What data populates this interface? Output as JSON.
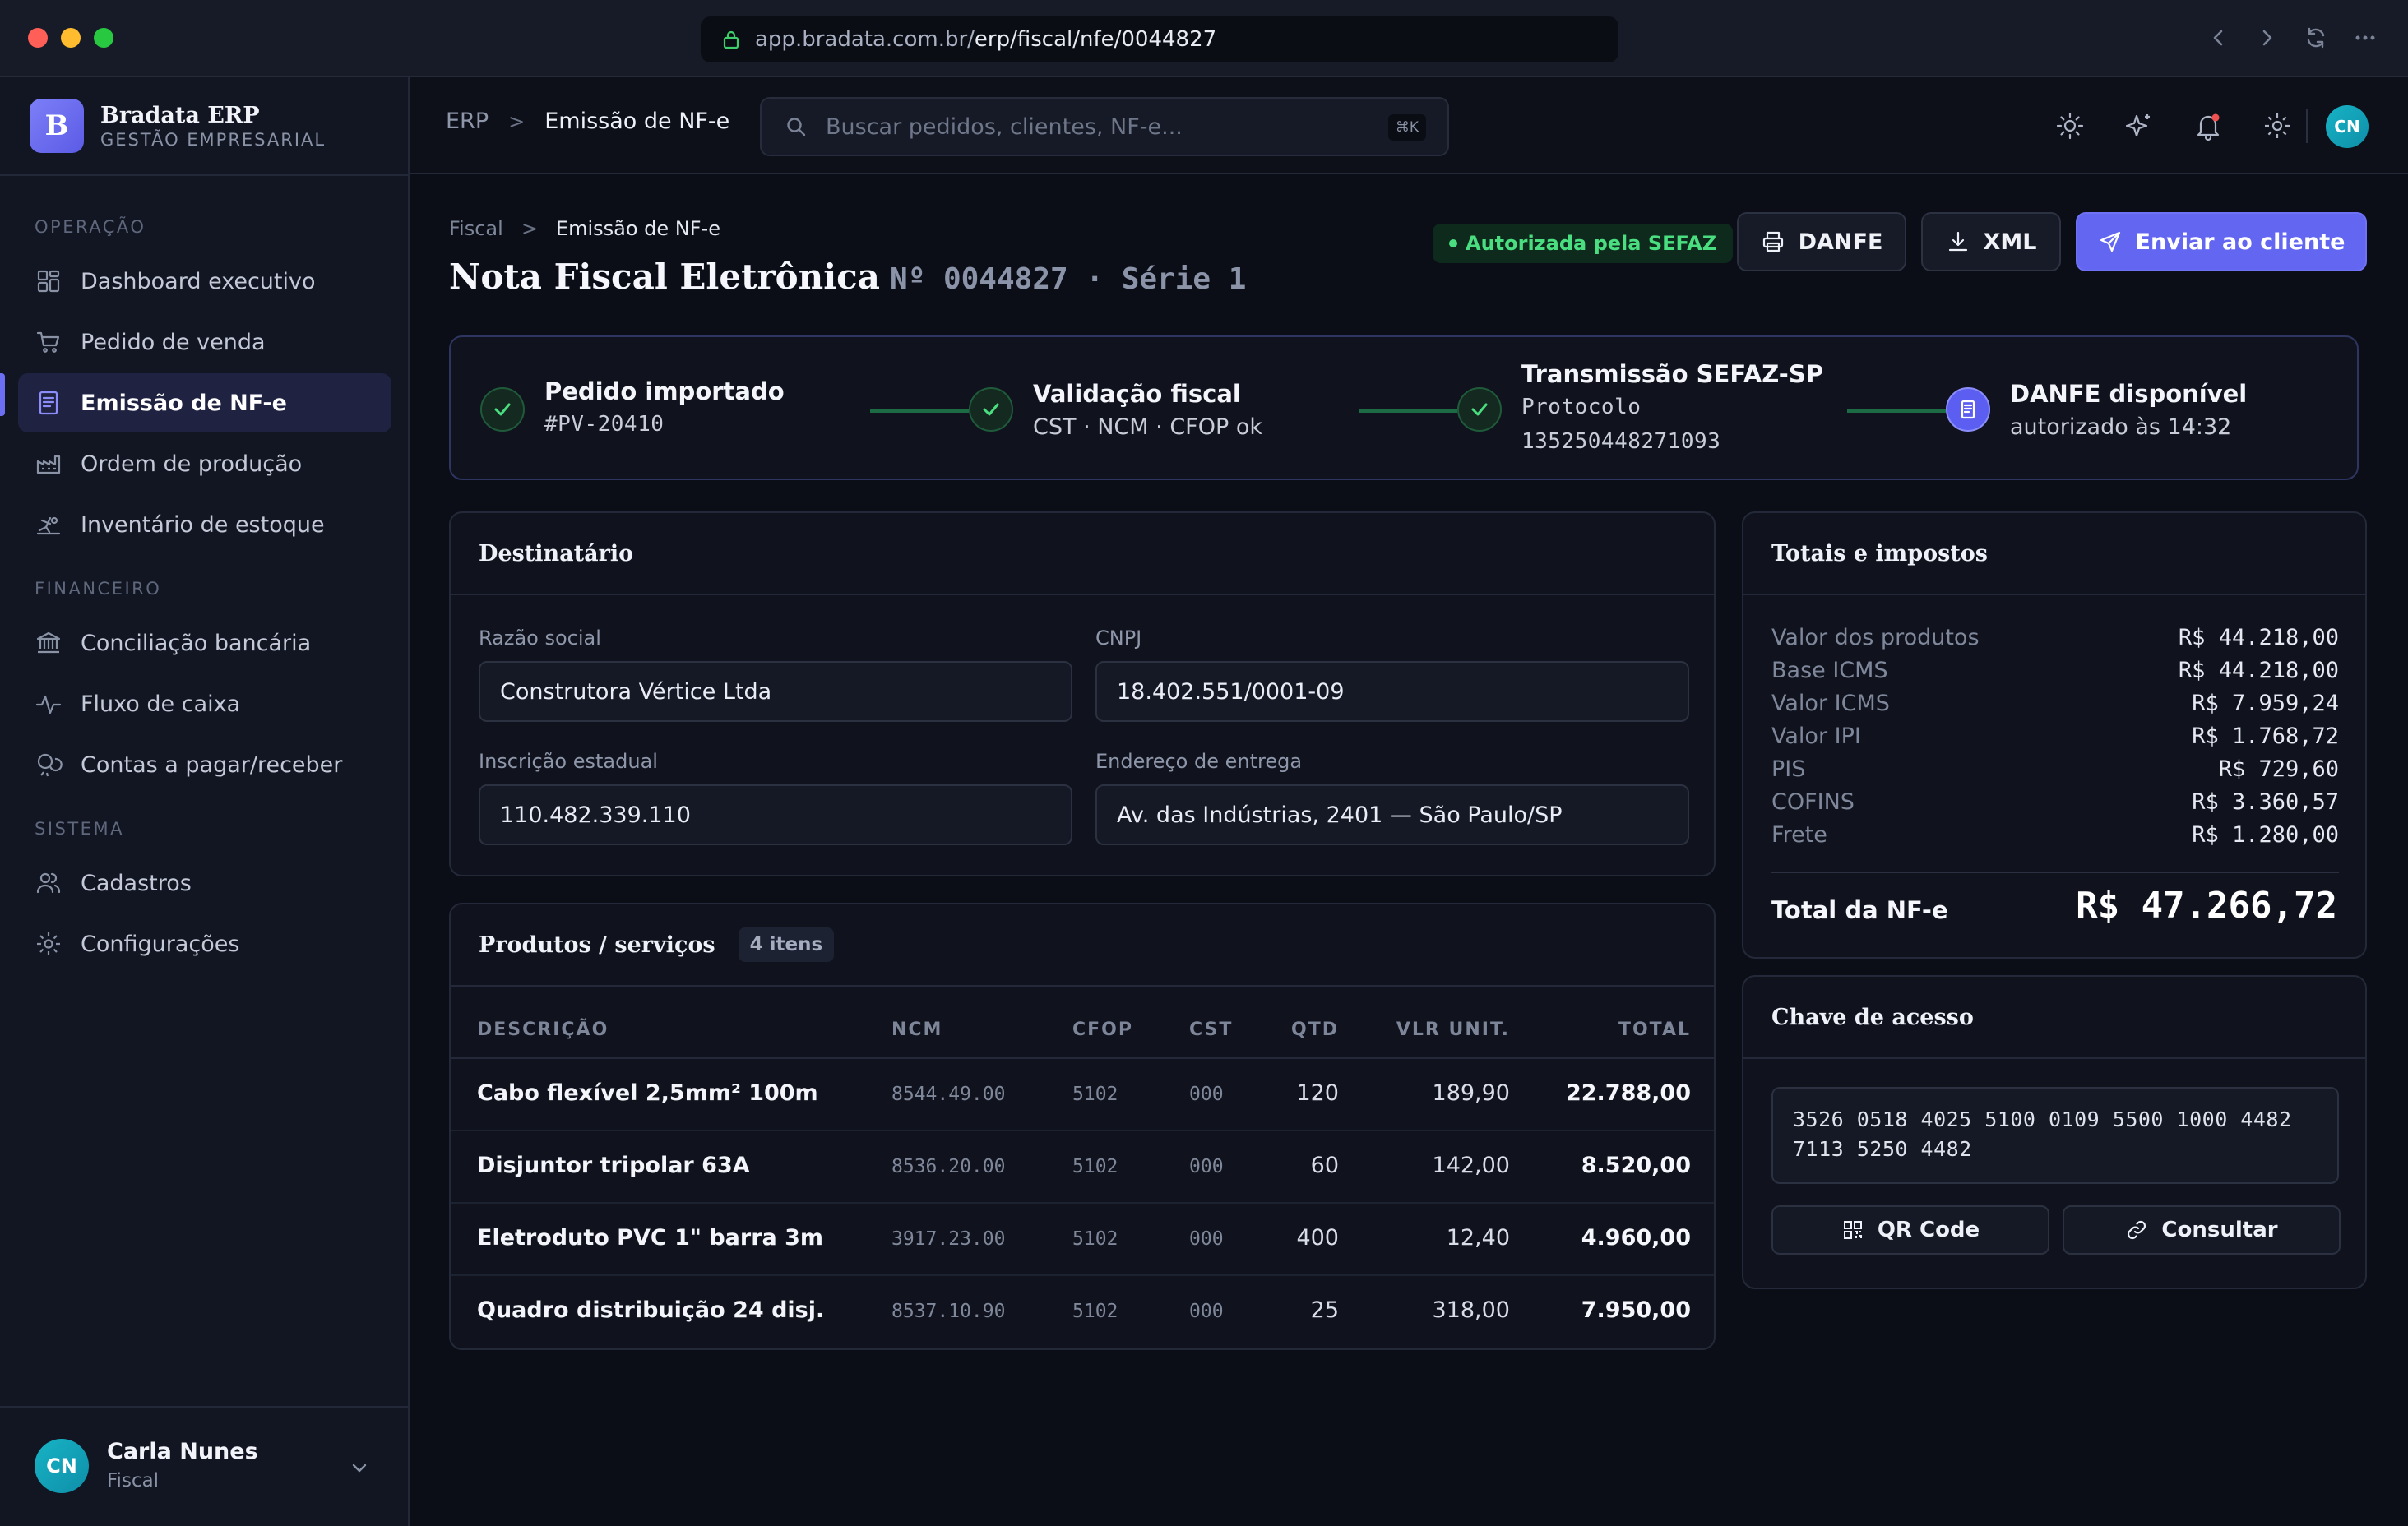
{
  "browser": {
    "url_domain": "app.bradata.com.br/",
    "url_path": "erp/fiscal/nfe/0044827"
  },
  "brand": {
    "logo_letter": "B",
    "name": "Bradata ERP",
    "subtitle": "GESTÃO EMPRESARIAL"
  },
  "sidebar": {
    "sections": [
      {
        "title": "OPERAÇÃO"
      },
      {
        "title": "FINANCEIRO"
      },
      {
        "title": "SISTEMA"
      }
    ],
    "items": [
      {
        "label": "Dashboard executivo",
        "icon": "dashboard-icon"
      },
      {
        "label": "Pedido de venda",
        "icon": "cart-icon"
      },
      {
        "label": "Emissão de NF-e",
        "icon": "invoice-icon",
        "active": true
      },
      {
        "label": "Ordem de produção",
        "icon": "factory-icon"
      },
      {
        "label": "Inventário de estoque",
        "icon": "forklift-icon"
      },
      {
        "label": "Conciliação bancária",
        "icon": "bank-icon"
      },
      {
        "label": "Fluxo de caixa",
        "icon": "activity-icon"
      },
      {
        "label": "Contas a pagar/receber",
        "icon": "coins-icon"
      },
      {
        "label": "Cadastros",
        "icon": "users-icon"
      },
      {
        "label": "Configurações",
        "icon": "gear-icon"
      }
    ],
    "user": {
      "initials": "CN",
      "name": "Carla Nunes",
      "role": "Fiscal"
    }
  },
  "topbar": {
    "breadcrumb": [
      "ERP",
      "Emissão de NF-e"
    ],
    "search_placeholder": "Buscar pedidos, clientes, NF-e...",
    "search_shortcut": "⌘K",
    "user_initials": "CN"
  },
  "page": {
    "breadcrumb": [
      "Fiscal",
      "Emissão de NF-e"
    ],
    "title": "Nota Fiscal Eletrônica",
    "number": "Nº 0044827 · Série 1",
    "status_badge": "Autorizada pela SEFAZ",
    "actions": {
      "danfe": "DANFE",
      "xml": "XML",
      "send": "Enviar ao cliente"
    }
  },
  "steps": [
    {
      "title": "Pedido importado",
      "sub": "#PV-20410",
      "state": "done"
    },
    {
      "title": "Validação fiscal",
      "sub": "CST · NCM · CFOP ok",
      "state": "done"
    },
    {
      "title": "Transmissão SEFAZ-SP",
      "sub": "Protocolo",
      "sub2": "135250448271093",
      "state": "done"
    },
    {
      "title": "DANFE disponível",
      "sub": "autorizado às 14:32",
      "state": "current"
    }
  ],
  "recipient": {
    "title": "Destinatário",
    "razao_label": "Razão social",
    "razao": "Construtora Vértice Ltda",
    "cnpj_label": "CNPJ",
    "cnpj": "18.402.551/0001-09",
    "ie_label": "Inscrição estadual",
    "ie": "110.482.339.110",
    "endereco_label": "Endereço de entrega",
    "endereco": "Av. das Indústrias, 2401 — São Paulo/SP"
  },
  "products": {
    "title": "Produtos / serviços",
    "count": "4 itens",
    "columns": [
      "DESCRIÇÃO",
      "NCM",
      "CFOP",
      "CST",
      "QTD",
      "VLR UNIT.",
      "TOTAL"
    ],
    "rows": [
      {
        "desc": "Cabo flexível 2,5mm² 100m",
        "ncm": "8544.49.00",
        "cfop": "5102",
        "cst": "000",
        "qtd": "120",
        "unit": "189,90",
        "total": "22.788,00"
      },
      {
        "desc": "Disjuntor tripolar 63A",
        "ncm": "8536.20.00",
        "cfop": "5102",
        "cst": "000",
        "qtd": "60",
        "unit": "142,00",
        "total": "8.520,00"
      },
      {
        "desc": "Eletroduto PVC 1\" barra 3m",
        "ncm": "3917.23.00",
        "cfop": "5102",
        "cst": "000",
        "qtd": "400",
        "unit": "12,40",
        "total": "4.960,00"
      },
      {
        "desc": "Quadro distribuição 24 disj.",
        "ncm": "8537.10.90",
        "cfop": "5102",
        "cst": "000",
        "qtd": "25",
        "unit": "318,00",
        "total": "7.950,00"
      }
    ]
  },
  "totals": {
    "title": "Totais e impostos",
    "rows": [
      {
        "k": "Valor dos produtos",
        "v": "R$ 44.218,00"
      },
      {
        "k": "Base ICMS",
        "v": "R$ 44.218,00"
      },
      {
        "k": "Valor ICMS",
        "v": "R$ 7.959,24"
      },
      {
        "k": "Valor IPI",
        "v": "R$ 1.768,72"
      },
      {
        "k": "PIS",
        "v": "R$ 729,60"
      },
      {
        "k": "COFINS",
        "v": "R$ 3.360,57"
      },
      {
        "k": "Frete",
        "v": "R$ 1.280,00"
      }
    ],
    "total_label": "Total da NF-e",
    "total_value": "R$ 47.266,72"
  },
  "access_key": {
    "title": "Chave de acesso",
    "line1": "3526 0518 4025 5100 0109 5500 1000 4482",
    "line2": "7113 5250 4482",
    "qr_label": "QR Code",
    "consult_label": "Consultar"
  },
  "colors": {
    "accent": "#6366f1",
    "success": "#4ade80",
    "background": "#0b0e17"
  }
}
